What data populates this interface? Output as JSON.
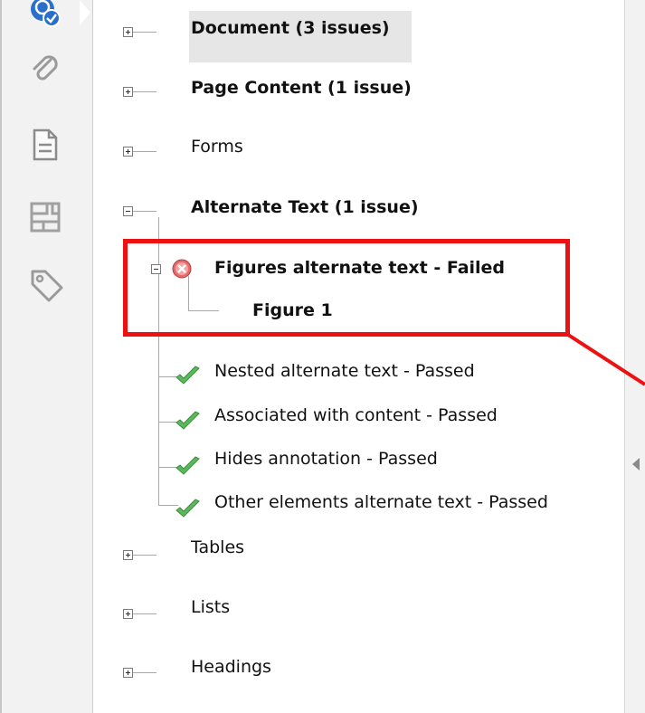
{
  "rail": {
    "icons": [
      "accessibility-check-icon",
      "paperclip-icon",
      "page-icon",
      "structure-icon",
      "tag-icon"
    ]
  },
  "tree": {
    "document": "Document (3 issues)",
    "page_content": "Page Content (1 issue)",
    "forms": "Forms",
    "alternate_text": "Alternate Text (1 issue)",
    "figures_failed": "Figures alternate text - Failed",
    "figure1": "Figure 1",
    "nested": "Nested alternate text - Passed",
    "associated": "Associated with content - Passed",
    "hides": "Hides annotation - Passed",
    "other": "Other elements alternate text - Passed",
    "tables": "Tables",
    "lists": "Lists",
    "headings": "Headings"
  },
  "colors": {
    "callout": "#ee1111",
    "pass": "#5cb85c",
    "fail": "#d9534f",
    "accent": "#2a6fc9"
  }
}
